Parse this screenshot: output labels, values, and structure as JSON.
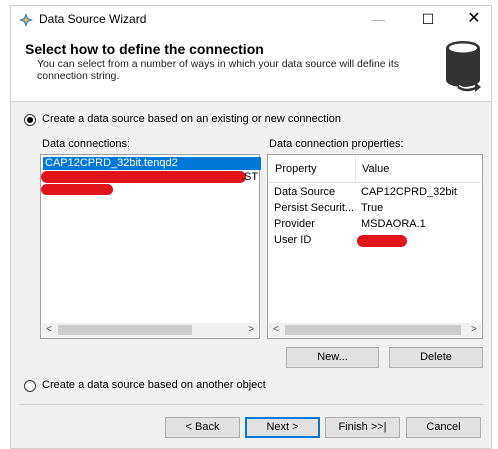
{
  "window": {
    "title": "Data Source Wizard",
    "minimize_glyph": "—",
    "maximize_glyph": "☐",
    "close_glyph": "✕"
  },
  "header": {
    "title": "Select how to define the connection",
    "description": "You can select from a number of ways in which your data source will define its connection string.",
    "icon": "database-icon"
  },
  "options": {
    "existing_label": "Create a data source based on an existing or new connection",
    "existing_selected": true,
    "other_label": "Create a data source based on another object",
    "other_selected": false
  },
  "connections": {
    "label": "Data connections:",
    "items": [
      "CAP12CPRD_32bit.tenqd2",
      ".ST"
    ],
    "selected_index": 0
  },
  "properties": {
    "label": "Data connection properties:",
    "col_property": "Property",
    "col_value": "Value",
    "rows": [
      {
        "name": "Data Source",
        "value": "CAP12CPRD_32bit"
      },
      {
        "name": "Persist Securit...",
        "value": "True"
      },
      {
        "name": "Provider",
        "value": "MSDAORA.1"
      },
      {
        "name": "User ID",
        "value": ""
      }
    ]
  },
  "actions": {
    "new_label": "New...",
    "delete_label": "Delete"
  },
  "footer": {
    "back_label": "< Back",
    "next_label": "Next >",
    "finish_label": "Finish >>|",
    "cancel_label": "Cancel"
  },
  "colors": {
    "selection": "#0078d7",
    "redaction": "#e3131b"
  }
}
